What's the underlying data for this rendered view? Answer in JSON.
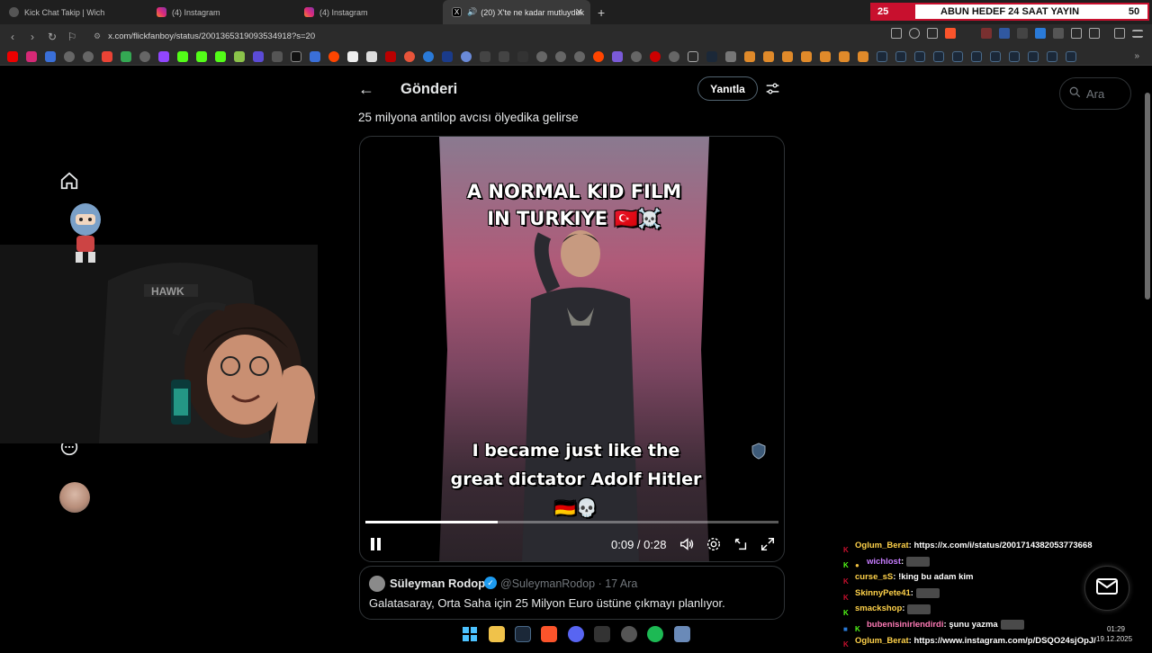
{
  "browser": {
    "tabs": [
      {
        "label": "Kick Chat Takip | Wich",
        "active": false
      },
      {
        "label": "(4) Instagram",
        "active": false
      },
      {
        "label": "(4) Instagram",
        "active": false
      },
      {
        "label": "(20) X'te ne kadar mutluyduk",
        "active": true
      }
    ],
    "new_tab": "+",
    "url": "x.com/flickfanboy/status/2001365319093534918?s=20"
  },
  "banner": {
    "left_number": "25",
    "text": "ABUN HEDEF 24 SAAT YAYIN",
    "right_number": "50"
  },
  "post": {
    "header_title": "Gönderi",
    "reply_label": "Yanıtla",
    "text": "25 milyona antilop avcısı ölyedika gelirse",
    "video": {
      "caption_top_line1": "A NORMAL KID FILM",
      "caption_top_line2": "IN TURKIYE 🇹🇷☠️",
      "caption_bottom_line1": "I became just like the",
      "caption_bottom_line2": "great dictator Adolf Hitler",
      "caption_bottom_line3": "🇩🇪💀",
      "timecode": "0:09 / 0:28",
      "progress": 0.32
    },
    "quote": {
      "name": "Süleyman Rodop",
      "handle": "@SuleymanRodop · 17 Ara",
      "text": "Galatasaray, Orta Saha için 25 Milyon Euro üstüne çıkmayı planlıyor."
    }
  },
  "search": {
    "placeholder": "Ara"
  },
  "chat": [
    {
      "user": "Oglum_Berat",
      "color": "#ffd24a",
      "msg": ": https://x.com/i/status/2001714382053773668"
    },
    {
      "user": "wichlost",
      "color": "#c77dff",
      "msg": ":"
    },
    {
      "user": "curse_sS",
      "color": "#ffd24a",
      "msg": ": !king bu adam kim"
    },
    {
      "user": "SkinnyPete41",
      "color": "#ffd24a",
      "msg": ":"
    },
    {
      "user": "smackshop",
      "color": "#ffd24a",
      "msg": ":"
    },
    {
      "user": "bubenisinirlendirdi",
      "color": "#ff7ab6",
      "msg": ": şunu yazma"
    },
    {
      "user": "Oglum_Berat",
      "color": "#ffd24a",
      "msg": ": https://www.instagram.com/p/DSQO24sjOpJ/"
    }
  ],
  "clock": {
    "time": "01:29",
    "date": "19.12.2025"
  },
  "colors": {
    "x_blue": "#1d9bf0",
    "kick_red": "#c8102e",
    "border": "#2f3336"
  }
}
